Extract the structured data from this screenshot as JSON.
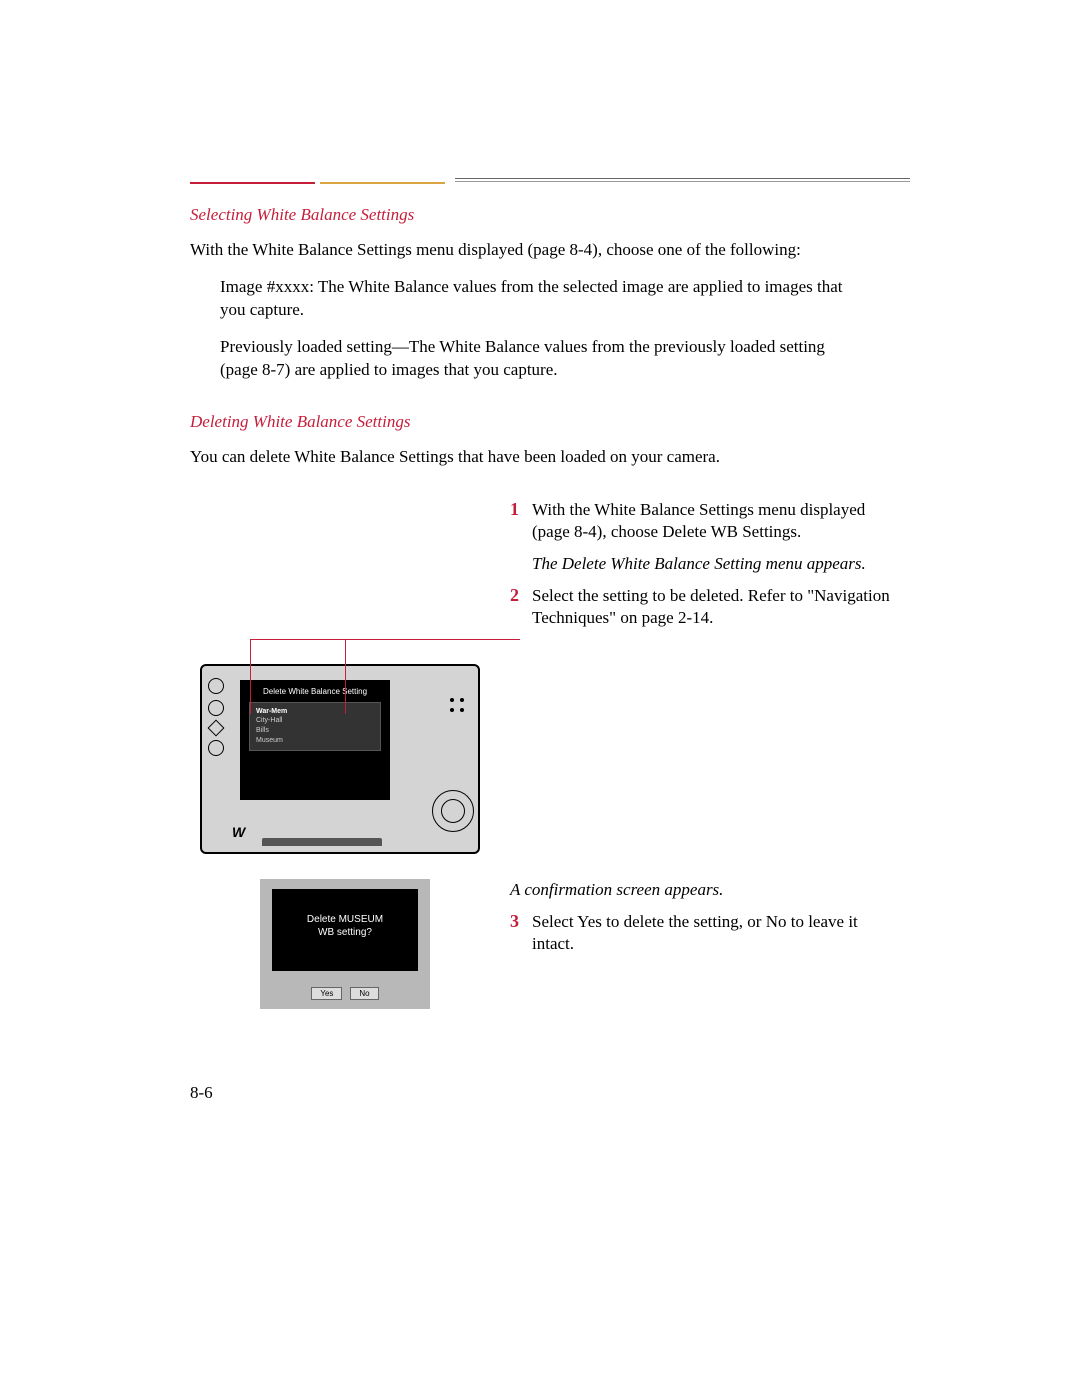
{
  "headings": {
    "selecting": "Selecting White Balance Settings",
    "deleting": "Deleting White Balance Settings"
  },
  "paragraphs": {
    "selecting_intro": "With the White Balance Settings menu displayed (page 8-4), choose one of the following:",
    "image_xxxx": "Image #xxxx: The White Balance values from the selected image are applied to images that you capture.",
    "prev_loaded": "Previously loaded setting—The White Balance values from the previously loaded setting (page 8-7) are applied to images that you capture.",
    "deleting_intro": "You can delete White Balance Settings that have been loaded on your camera."
  },
  "steps": {
    "s1": "With the White Balance Settings menu displayed (page 8-4), choose Delete WB Settings.",
    "s1_result": "The Delete White Balance Setting menu appears.",
    "s2": "Select the setting to be deleted. Refer to \"Navigation Techniques\" on page 2-14.",
    "s2_result": "A confirmation screen appears.",
    "s3": "Select Yes to delete the setting, or No to leave it intact."
  },
  "step_nums": {
    "n1": "1",
    "n2": "2",
    "n3": "3"
  },
  "lcd": {
    "title": "Delete White Balance Setting",
    "items": [
      "War-Mem",
      "City-Hall",
      "Bills",
      "Museum"
    ]
  },
  "confirm": {
    "line1": "Delete MUSEUM",
    "line2": "WB setting?",
    "yes": "Yes",
    "no": "No"
  },
  "page_number": "8-6"
}
